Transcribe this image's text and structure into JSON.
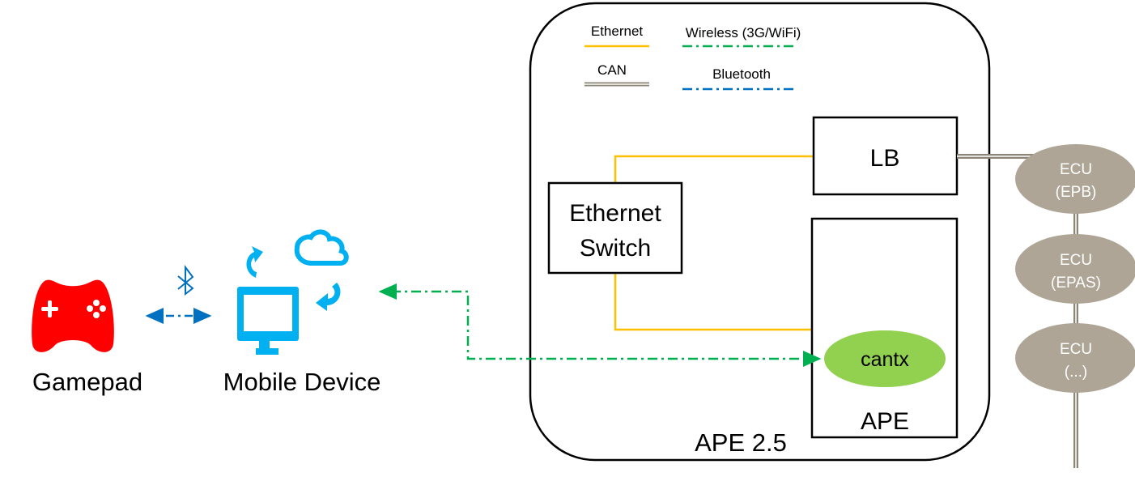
{
  "legend": {
    "ethernet": "Ethernet",
    "wireless": "Wireless (3G/WiFi)",
    "can": "CAN",
    "bluetooth": "Bluetooth"
  },
  "nodes": {
    "gamepad": "Gamepad",
    "mobile": "Mobile Device",
    "switch_line1": "Ethernet",
    "switch_line2": "Switch",
    "lb": "LB",
    "cantx": "cantx",
    "ape": "APE",
    "container": "APE 2.5",
    "ecus": [
      {
        "line1": "ECU",
        "line2": "(EPB)"
      },
      {
        "line1": "ECU",
        "line2": "(EPAS)"
      },
      {
        "line1": "ECU",
        "line2": "(...)"
      }
    ]
  },
  "colors": {
    "ethernet": "#ffc000",
    "wireless": "#00b050",
    "can": "#8c8475",
    "bluetooth": "#0070c0",
    "gamepad": "#ff0000",
    "mobile": "#00b0f0",
    "cantx": "#92d050",
    "ecu": "#aea596"
  }
}
